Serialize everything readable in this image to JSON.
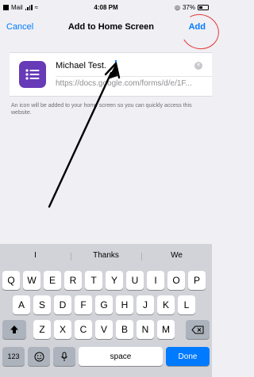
{
  "status_bar": {
    "back_label": "Mail",
    "time": "4:08 PM",
    "battery_text": "37%"
  },
  "navbar": {
    "cancel_label": "Cancel",
    "title": "Add to Home Screen",
    "add_label": "Add"
  },
  "shortcut": {
    "name_value": "Michael Test.",
    "url_text": "https://docs.google.com/forms/d/e/1F...",
    "info_text": "An icon will be added to your home screen so you can quickly access this website."
  },
  "keyboard": {
    "suggestions": [
      "I",
      "Thanks",
      "We"
    ],
    "row1": [
      "Q",
      "W",
      "E",
      "R",
      "T",
      "Y",
      "U",
      "I",
      "O",
      "P"
    ],
    "row2": [
      "A",
      "S",
      "D",
      "F",
      "G",
      "H",
      "J",
      "K",
      "L"
    ],
    "row3": [
      "Z",
      "X",
      "C",
      "V",
      "B",
      "N",
      "M"
    ],
    "numbers_label": "123",
    "space_label": "space",
    "done_label": "Done"
  }
}
